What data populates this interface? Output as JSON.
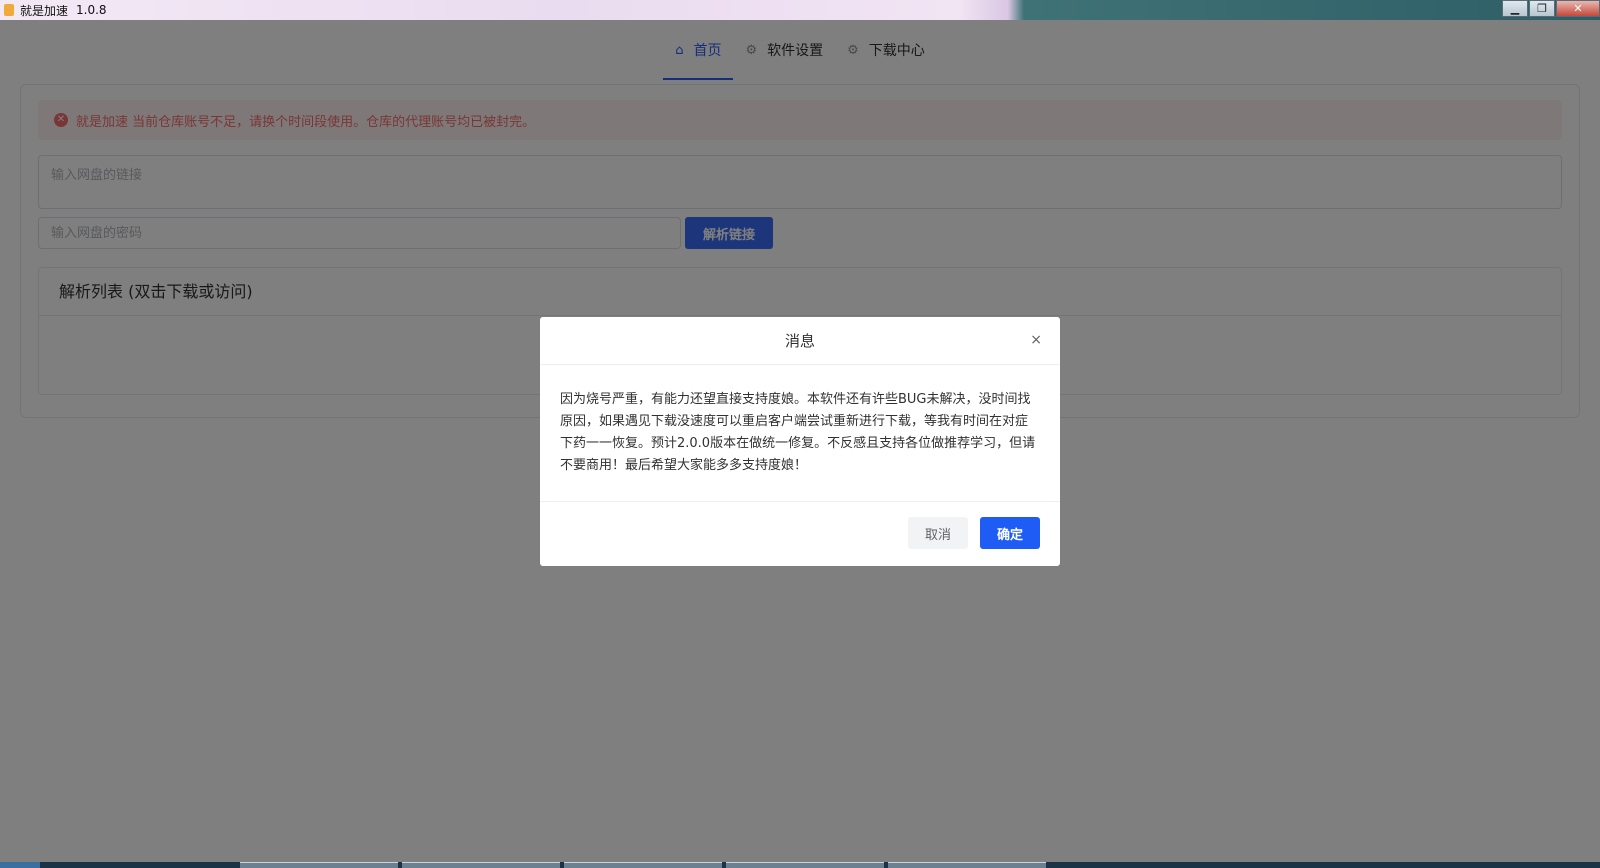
{
  "window": {
    "title": "就是加速",
    "version": "1.0.8",
    "controls": {
      "minimize": "▁",
      "restore": "❐",
      "close": "✕"
    }
  },
  "nav": {
    "tabs": [
      {
        "label": "首页",
        "icon": "home-icon",
        "active": true
      },
      {
        "label": "软件设置",
        "icon": "gear-icon",
        "active": false
      },
      {
        "label": "下载中心",
        "icon": "gear-icon",
        "active": false
      }
    ]
  },
  "alert": {
    "icon": "error-circle-icon",
    "text": "就是加速 当前仓库账号不足，请换个时间段使用。仓库的代理账号均已被封完。"
  },
  "form": {
    "link_placeholder": "输入网盘的链接",
    "password_placeholder": "输入网盘的密码",
    "parse_button": "解析链接"
  },
  "list": {
    "title": "解析列表 (双击下载或访问)"
  },
  "dialog": {
    "title": "消息",
    "close": "×",
    "message": "因为烧号严重，有能力还望直接支持度娘。本软件还有许些BUG未解决，没时间找原因，如果遇见下载没速度可以重启客户端尝试重新进行下载，等我有时间在对症下药一一恢复。预计2.0.0版本在做统一修复。不反感且支持各位做推荐学习，但请不要商用！最后希望大家能多多支持度娘！",
    "cancel": "取消",
    "confirm": "确定"
  },
  "colors": {
    "accent": "#2a5cf4",
    "error": "#f56c6c",
    "overlay": "rgba(0,0,0,0.5)"
  }
}
